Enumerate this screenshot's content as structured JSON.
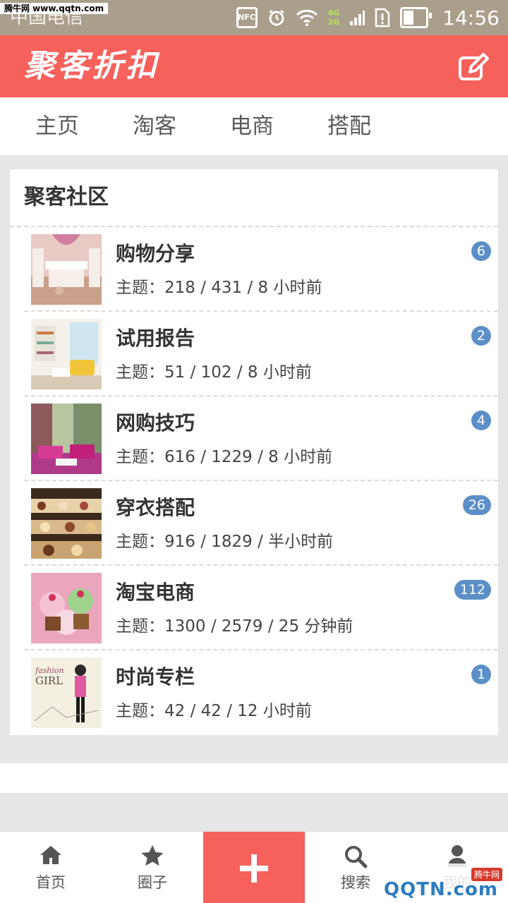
{
  "status_bar": {
    "watermark": "腾牛网 www.qqtn.com",
    "carrier": "中国电信",
    "nfc_label": "NFC",
    "net_4g": "4G",
    "net_2g": "2G",
    "battery_level": 0.4,
    "time": "14:56"
  },
  "app_bar": {
    "logo": "聚客折扣",
    "edit_icon": "edit-icon"
  },
  "tabs": [
    {
      "label": "主页"
    },
    {
      "label": "淘客"
    },
    {
      "label": "电商"
    },
    {
      "label": "搭配"
    }
  ],
  "community": {
    "title": "聚客社区",
    "stats_prefix": "主题：",
    "boards": [
      {
        "name": "购物分享",
        "stats": "218 / 431 / 8 小时前",
        "badge": "6",
        "thumb": "bedroom"
      },
      {
        "name": "试用报告",
        "stats": "51 / 102 / 8 小时前",
        "badge": "2",
        "thumb": "living-room"
      },
      {
        "name": "网购技巧",
        "stats": "616 / 1229 / 8 小时前",
        "badge": "4",
        "thumb": "pink-room"
      },
      {
        "name": "穿衣搭配",
        "stats": "916 / 1829 / 半小时前",
        "badge": "26",
        "thumb": "pastries"
      },
      {
        "name": "淘宝电商",
        "stats": "1300 / 2579 / 25 分钟前",
        "badge": "112",
        "thumb": "cupcakes"
      },
      {
        "name": "时尚专栏",
        "stats": "42 / 42 / 12 小时前",
        "badge": "1",
        "thumb": "fashion-girl"
      }
    ],
    "fashion_thumb_text_1": "fashion",
    "fashion_thumb_text_2": "GIRL"
  },
  "bottom_nav": {
    "home": "首页",
    "circle": "圈子",
    "search": "搜索",
    "me": "我的"
  },
  "bottom_watermark": {
    "tag": "腾牛网",
    "text": "QQTN.com"
  },
  "colors": {
    "accent": "#f6615c",
    "badge": "#5c8fc8",
    "status_bar": "#a99f8b"
  }
}
